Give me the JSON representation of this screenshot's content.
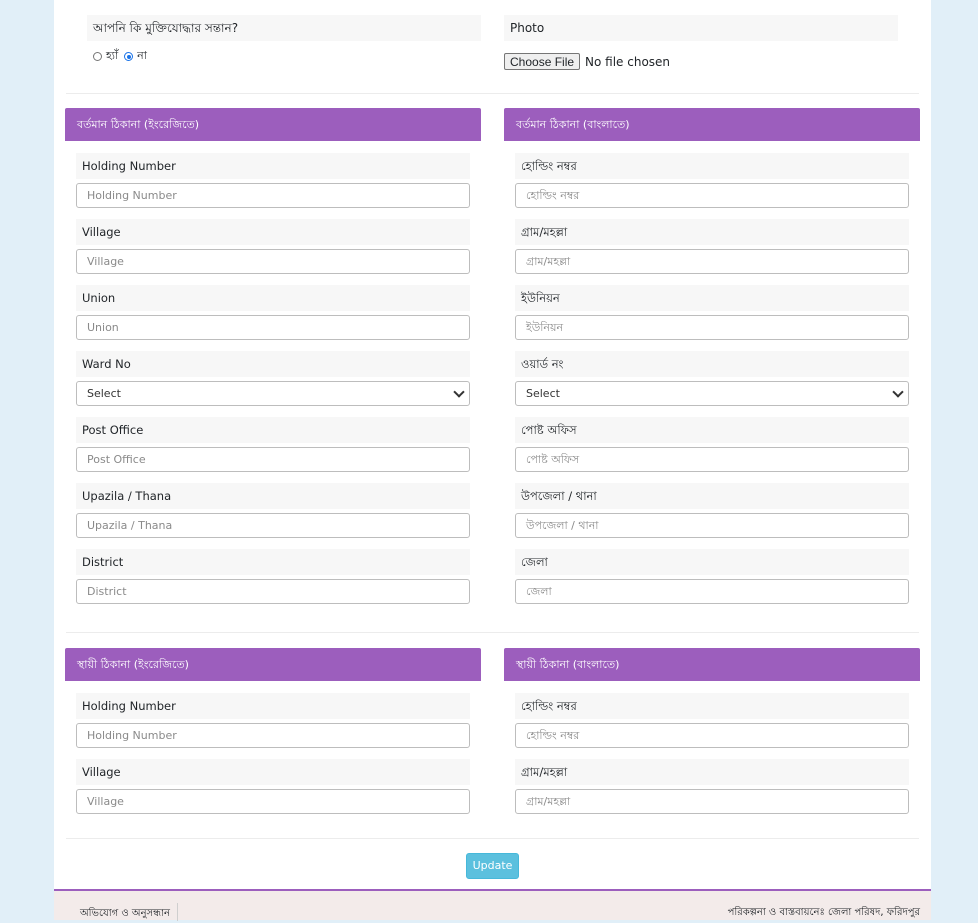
{
  "freedom_fighter": {
    "question": "আপনি কি মুক্তিযোদ্ধার সন্তান?",
    "options": [
      "হ্যাঁ",
      "না"
    ],
    "selected": "না"
  },
  "photo": {
    "label": "Photo",
    "button": "Choose File",
    "status": "No file chosen"
  },
  "present_en": {
    "title": "বর্তমান ঠিকানা (ইংরেজিতে)",
    "fields": [
      {
        "label": "Holding Number",
        "placeholder": "Holding Number"
      },
      {
        "label": "Village",
        "placeholder": "Village"
      },
      {
        "label": "Union",
        "placeholder": " Union"
      },
      {
        "label": "Ward No",
        "placeholder": "Select"
      },
      {
        "label": "Post Office",
        "placeholder": "Post Office"
      },
      {
        "label": "Upazila / Thana",
        "placeholder": "Upazila / Thana"
      },
      {
        "label": "District",
        "placeholder": "District"
      }
    ]
  },
  "present_bn": {
    "title": "বর্তমান ঠিকানা (বাংলাতে)",
    "fields": [
      {
        "label": "হোল্ডিং নম্বর",
        "placeholder": "হোল্ডিং নম্বর"
      },
      {
        "label": "গ্রাম/মহল্লা",
        "placeholder": "গ্রাম/মহল্লা"
      },
      {
        "label": "ইউনিয়ন",
        "placeholder": " ইউনিয়ন"
      },
      {
        "label": "ওয়ার্ড নং",
        "placeholder": "Select"
      },
      {
        "label": "পোষ্ট অফিস",
        "placeholder": " পোষ্ট অফিস"
      },
      {
        "label": "উপজেলা / থানা",
        "placeholder": "উপজেলা / থানা"
      },
      {
        "label": "জেলা",
        "placeholder": "জেলা"
      }
    ]
  },
  "permanent_en": {
    "title": "স্থায়ী ঠিকানা (ইংরেজিতে)",
    "fields": [
      {
        "label": "Holding Number",
        "placeholder": "Holding Number"
      },
      {
        "label": "Village",
        "placeholder": "Village"
      }
    ]
  },
  "permanent_bn": {
    "title": "স্থায়ী ঠিকানা (বাংলাতে)",
    "fields": [
      {
        "label": "হোল্ডিং নম্বর",
        "placeholder": "হোল্ডিং নম্বর"
      },
      {
        "label": "গ্রাম/মহল্লা",
        "placeholder": "গ্রাম/মহল্লা"
      }
    ]
  },
  "update_label": "Update",
  "footer": {
    "left": "অভিযোগ ও অনুসন্ধান",
    "right": "পরিকল্পনা ও বাস্তবায়নেঃ জেলা পরিষদ, ফরিদপুর"
  },
  "colors": {
    "panel_header": "#9c5ebd",
    "update_button": "#5bc0de",
    "background": "#e1eff8"
  }
}
